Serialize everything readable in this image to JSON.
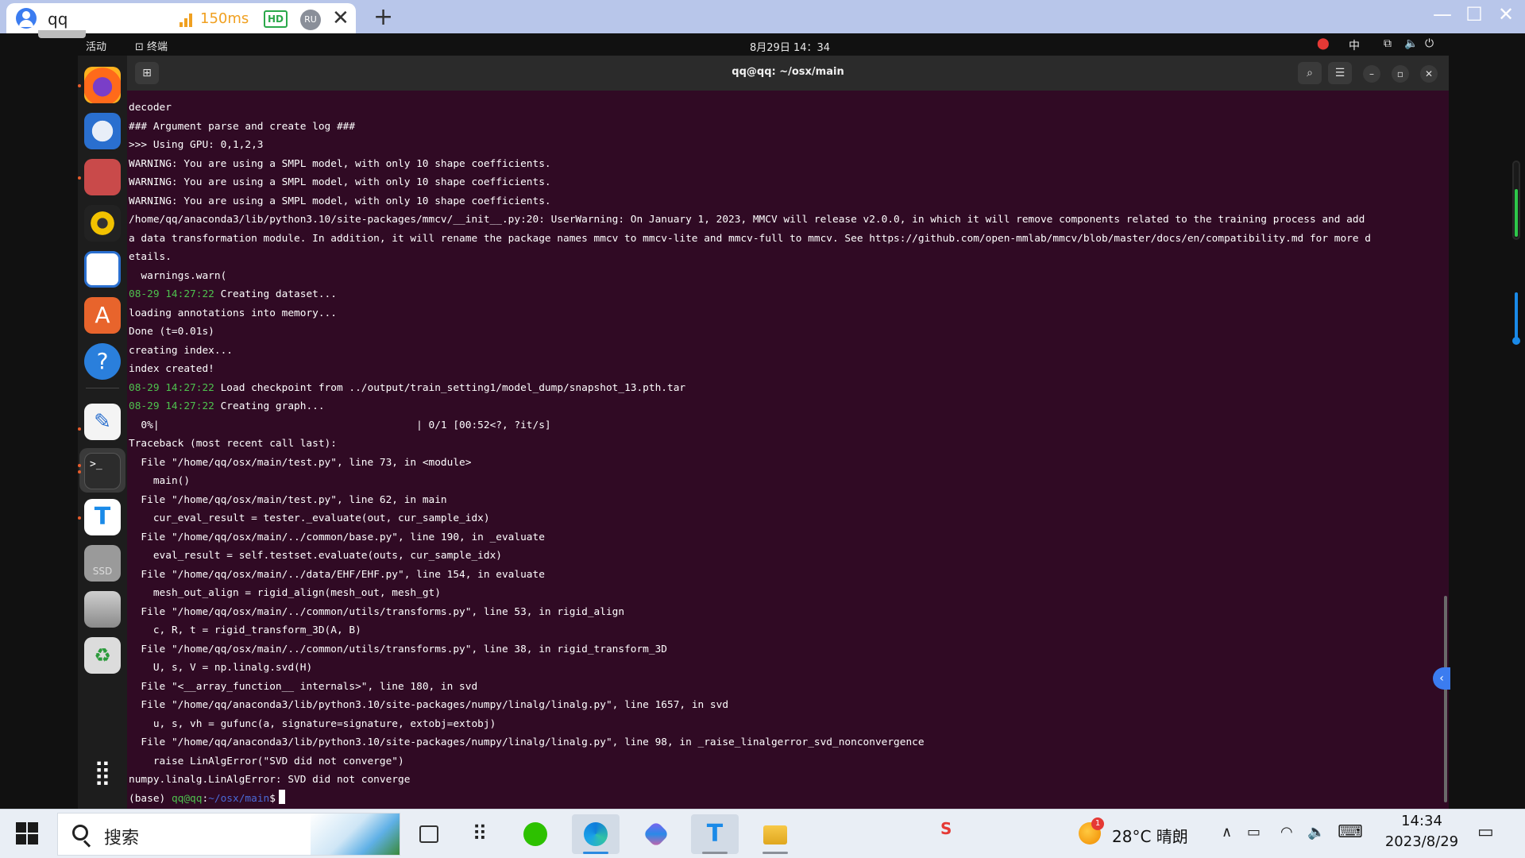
{
  "client": {
    "tab_title": "qq",
    "latency": "150ms",
    "hd_label": "HD",
    "user_badge": "RU",
    "close_glyph": "✕",
    "new_tab_glyph": "+"
  },
  "gnome": {
    "activities": "活动",
    "app_name": "⊡ 终端",
    "clock": "8月29日  14：34",
    "ime": "中"
  },
  "terminal": {
    "title": "qq@qq: ~/osx/main",
    "lines": [
      {
        "text": "decoder"
      },
      {
        "text": "### Argument parse and create log ###"
      },
      {
        "text": ">>> Using GPU: 0,1,2,3"
      },
      {
        "text": "WARNING: You are using a SMPL model, with only 10 shape coefficients."
      },
      {
        "text": "WARNING: You are using a SMPL model, with only 10 shape coefficients."
      },
      {
        "text": "WARNING: You are using a SMPL model, with only 10 shape coefficients."
      },
      {
        "text": "/home/qq/anaconda3/lib/python3.10/site-packages/mmcv/__init__.py:20: UserWarning: On January 1, 2023, MMCV will release v2.0.0, in which it will remove components related to the training process and add"
      },
      {
        "text": "a data transformation module. In addition, it will rename the package names mmcv to mmcv-lite and mmcv-full to mmcv. See https://github.com/open-mmlab/mmcv/blob/master/docs/en/compatibility.md for more d"
      },
      {
        "text": "etails."
      },
      {
        "text": "  warnings.warn("
      },
      {
        "ts": "08-29 14:27:22",
        "text": " Creating dataset..."
      },
      {
        "text": "loading annotations into memory..."
      },
      {
        "text": "Done (t=0.01s)"
      },
      {
        "text": "creating index..."
      },
      {
        "text": "index created!"
      },
      {
        "ts": "08-29 14:27:22",
        "text": " Load checkpoint from ../output/train_setting1/model_dump/snapshot_13.pth.tar"
      },
      {
        "ts": "08-29 14:27:22",
        "text": " Creating graph..."
      },
      {
        "text": "  0%|                                          | 0/1 [00:52<?, ?it/s]"
      },
      {
        "text": "Traceback (most recent call last):"
      },
      {
        "text": "  File \"/home/qq/osx/main/test.py\", line 73, in <module>"
      },
      {
        "text": "    main()"
      },
      {
        "text": "  File \"/home/qq/osx/main/test.py\", line 62, in main"
      },
      {
        "text": "    cur_eval_result = tester._evaluate(out, cur_sample_idx)"
      },
      {
        "text": "  File \"/home/qq/osx/main/../common/base.py\", line 190, in _evaluate"
      },
      {
        "text": "    eval_result = self.testset.evaluate(outs, cur_sample_idx)"
      },
      {
        "text": "  File \"/home/qq/osx/main/../data/EHF/EHF.py\", line 154, in evaluate"
      },
      {
        "text": "    mesh_out_align = rigid_align(mesh_out, mesh_gt)"
      },
      {
        "text": "  File \"/home/qq/osx/main/../common/utils/transforms.py\", line 53, in rigid_align"
      },
      {
        "text": "    c, R, t = rigid_transform_3D(A, B)"
      },
      {
        "text": "  File \"/home/qq/osx/main/../common/utils/transforms.py\", line 38, in rigid_transform_3D"
      },
      {
        "text": "    U, s, V = np.linalg.svd(H)"
      },
      {
        "text": "  File \"<__array_function__ internals>\", line 180, in svd"
      },
      {
        "text": "  File \"/home/qq/anaconda3/lib/python3.10/site-packages/numpy/linalg/linalg.py\", line 1657, in svd"
      },
      {
        "text": "    u, s, vh = gufunc(a, signature=signature, extobj=extobj)"
      },
      {
        "text": "  File \"/home/qq/anaconda3/lib/python3.10/site-packages/numpy/linalg/linalg.py\", line 98, in _raise_linalgerror_svd_nonconvergence"
      },
      {
        "text": "    raise LinAlgError(\"SVD did not converge\")"
      },
      {
        "text": "numpy.linalg.LinAlgError: SVD did not converge"
      }
    ],
    "prompt": {
      "env": "(base) ",
      "user": "qq@qq",
      "sep": ":",
      "path": "~/osx/main",
      "symbol": "$"
    }
  },
  "taskbar": {
    "search_label": "搜索",
    "weather_badge": "1",
    "weather": "28°C  晴朗",
    "time": "14:34",
    "date": "2023/8/29"
  },
  "colors": {
    "terminal_bg": "#300a24",
    "timestamp": "#4ec24e",
    "prompt_path": "#4a6ad8"
  }
}
